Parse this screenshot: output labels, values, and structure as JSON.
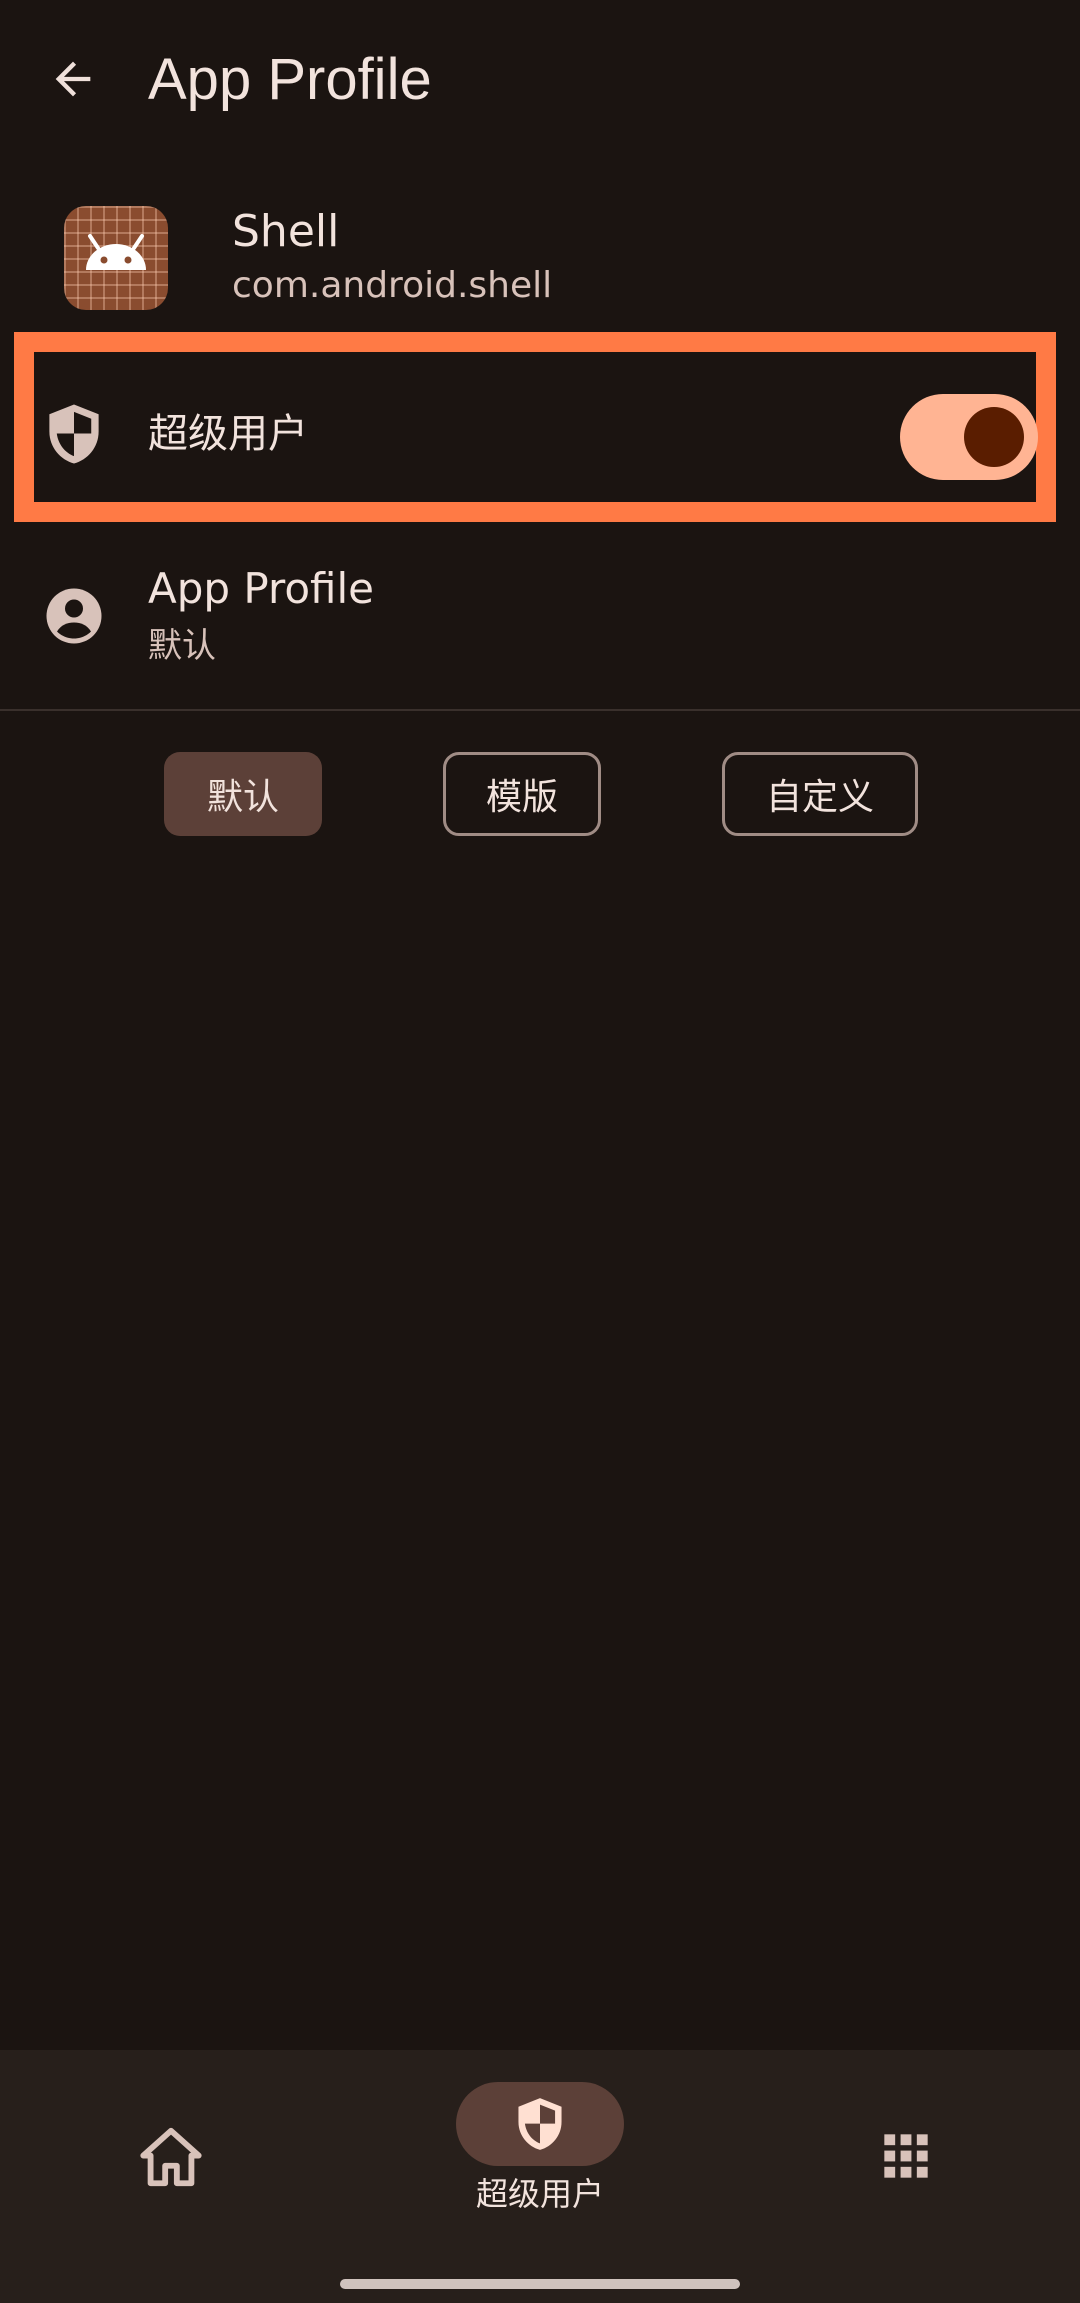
{
  "header": {
    "title": "App Profile",
    "back_icon": "arrow-back-icon"
  },
  "app": {
    "name": "Shell",
    "package": "com.android.shell",
    "icon": "android-icon"
  },
  "superuser": {
    "label": "超级用户",
    "icon": "shield-icon",
    "enabled": true
  },
  "app_profile": {
    "title": "App Profile",
    "value": "默认",
    "icon": "account-circle-icon"
  },
  "profile_modes": {
    "options": [
      "默认",
      "模版",
      "自定义"
    ],
    "selected": "默认"
  },
  "bottom_nav": {
    "items": [
      {
        "icon": "home-icon",
        "label": ""
      },
      {
        "icon": "shield-icon",
        "label": "超级用户",
        "selected": true
      },
      {
        "icon": "apps-grid-icon",
        "label": ""
      }
    ]
  },
  "colors": {
    "background": "#1b1411",
    "accent": "#ffb493",
    "highlight": "#ff7a45",
    "chip_selected": "#5c4038"
  }
}
